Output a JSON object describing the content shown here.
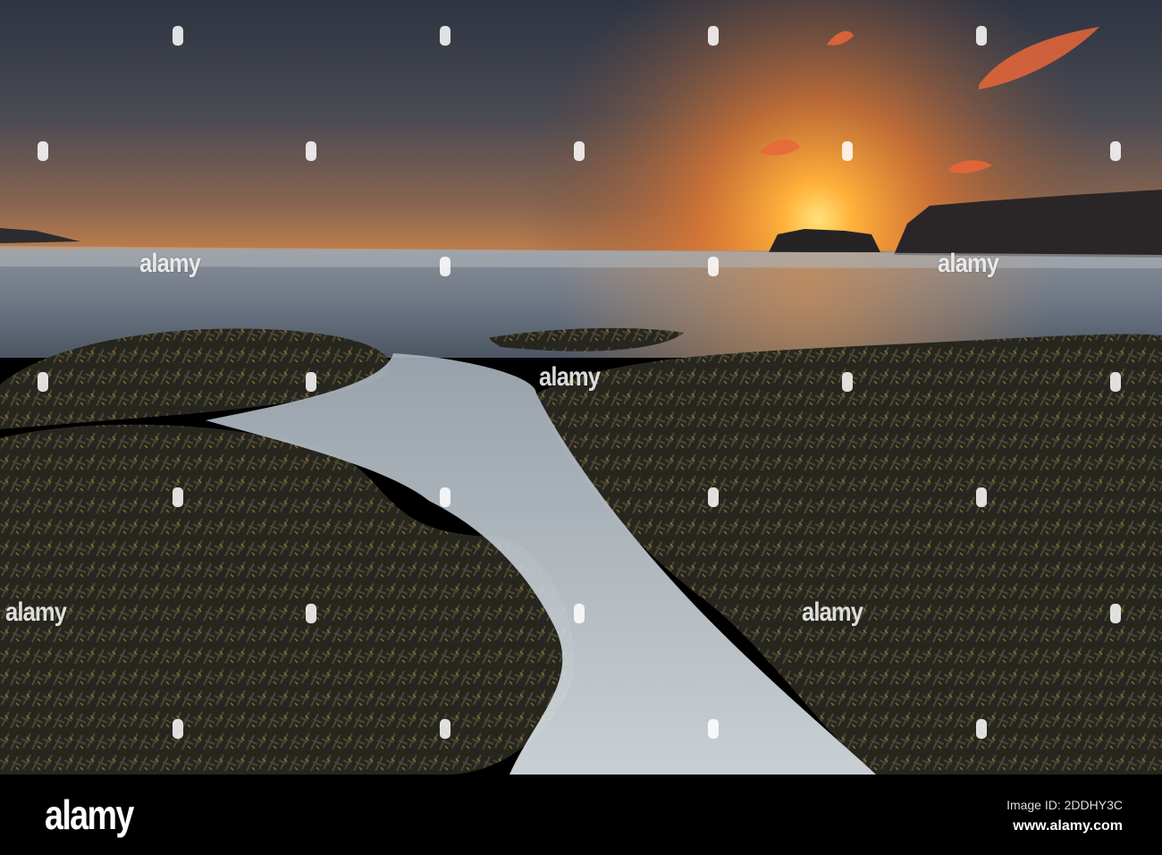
{
  "photo": {
    "subject": "sunset over rocky seaweed shore",
    "colors": {
      "sun": "#ffb13a",
      "sky_top": "#2f3745",
      "sea": "#6c7684",
      "seaweed": "#2a271d"
    }
  },
  "watermark": {
    "text": "alamy"
  },
  "footer": {
    "logo": "alamy",
    "image_id": "Image ID: 2DDHY3C",
    "website": "www.alamy.com"
  }
}
